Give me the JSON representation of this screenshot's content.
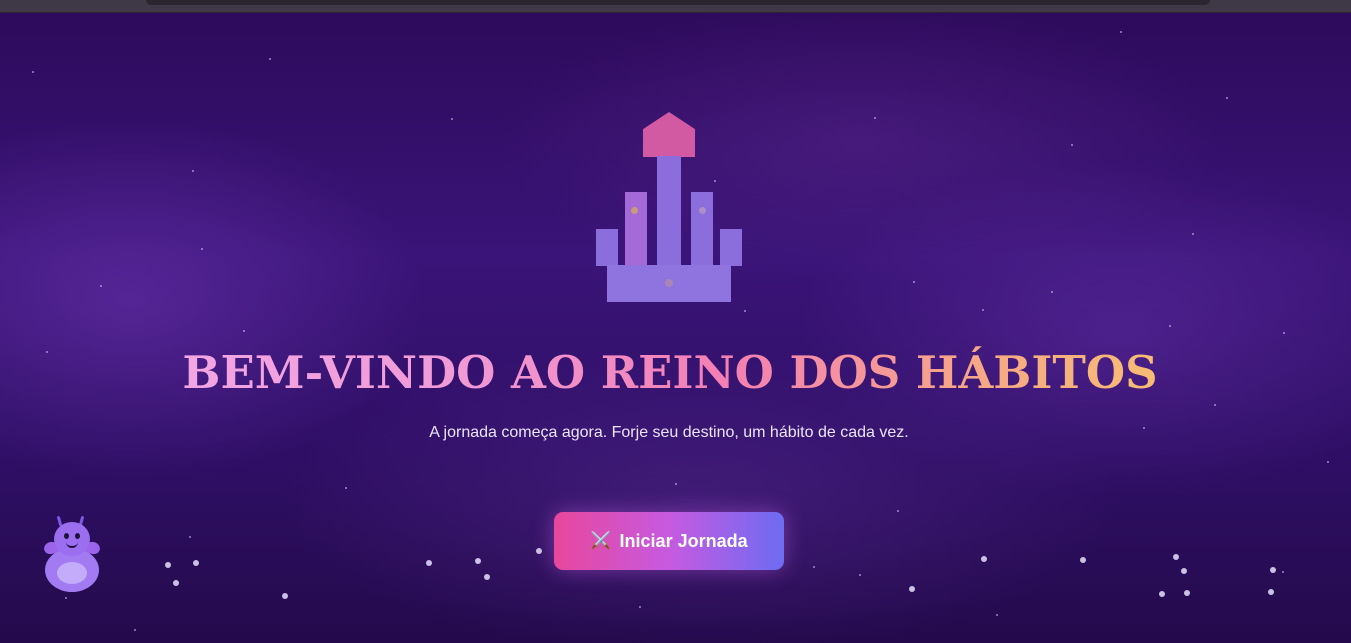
{
  "hero": {
    "title": "BEM-VINDO AO REINO DOS HÁBITOS",
    "subtitle": "A jornada começa agora. Forje seu destino, um hábito de cada vez.",
    "cta_icon": "⚔️",
    "cta_label": "Iniciar Jornada"
  },
  "icons": {
    "hero_emblem": "castle-icon",
    "cta_icon": "crossed-swords-icon",
    "mascot": "mascot-icon"
  },
  "colors": {
    "background_top": "#2d0a5a",
    "background_bottom": "#240a4c",
    "title_gradient_start": "#f3a8e6",
    "title_gradient_end": "#f7c070",
    "cta_gradient_start": "#e8479c",
    "cta_gradient_end": "#6d6cf2",
    "castle_roof": "#d15aa3",
    "castle_body": "#8b6ddc"
  }
}
